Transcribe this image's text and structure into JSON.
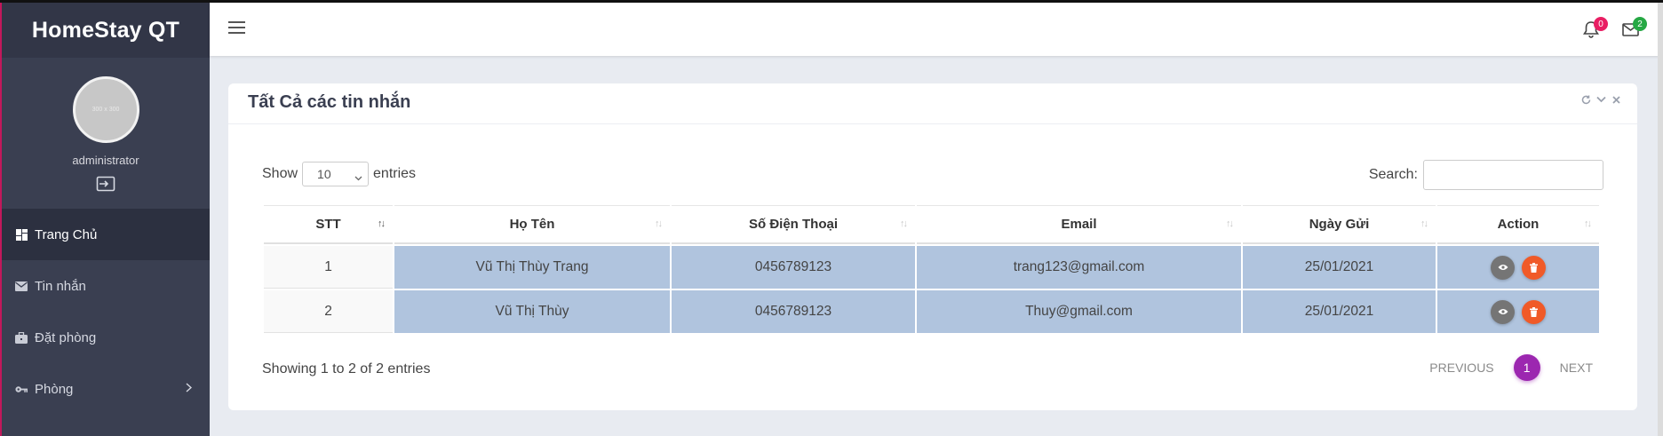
{
  "brand": "HomeStay QT",
  "user": {
    "avatar_text": "300 x 300",
    "name": "administrator"
  },
  "nav": [
    {
      "label": "Trang Chủ",
      "icon": "dashboard-icon"
    },
    {
      "label": "Tin nhắn",
      "icon": "envelope-icon"
    },
    {
      "label": "Đặt phòng",
      "icon": "briefcase-icon"
    },
    {
      "label": "Phòng",
      "icon": "key-icon"
    }
  ],
  "topbar": {
    "notifications_count": "0",
    "messages_count": "2"
  },
  "card": {
    "title": "Tất Cả các tin nhắn"
  },
  "table_controls": {
    "show_label": "Show",
    "entries_value": "10",
    "entries_label": "entries",
    "search_label": "Search:"
  },
  "table": {
    "headers": [
      "STT",
      "Họ Tên",
      "Số Điện Thoại",
      "Email",
      "Ngày Gửi",
      "Action"
    ],
    "rows": [
      {
        "stt": "1",
        "name": "Vũ Thị Thùy Trang",
        "phone": "0456789123",
        "email": "trang123@gmail.com",
        "date": "25/01/2021"
      },
      {
        "stt": "2",
        "name": "Vũ Thị Thùy",
        "phone": "0456789123",
        "email": "Thuy@gmail.com",
        "date": "25/01/2021"
      }
    ]
  },
  "footer": {
    "info": "Showing 1 to 2 of 2 entries",
    "previous": "PREVIOUS",
    "page": "1",
    "next": "NEXT"
  },
  "colors": {
    "sidebar": "#3a3f51",
    "selected_row": "#b0c4de",
    "page_active": "#9c27b0",
    "delete_button": "#f05a28"
  }
}
